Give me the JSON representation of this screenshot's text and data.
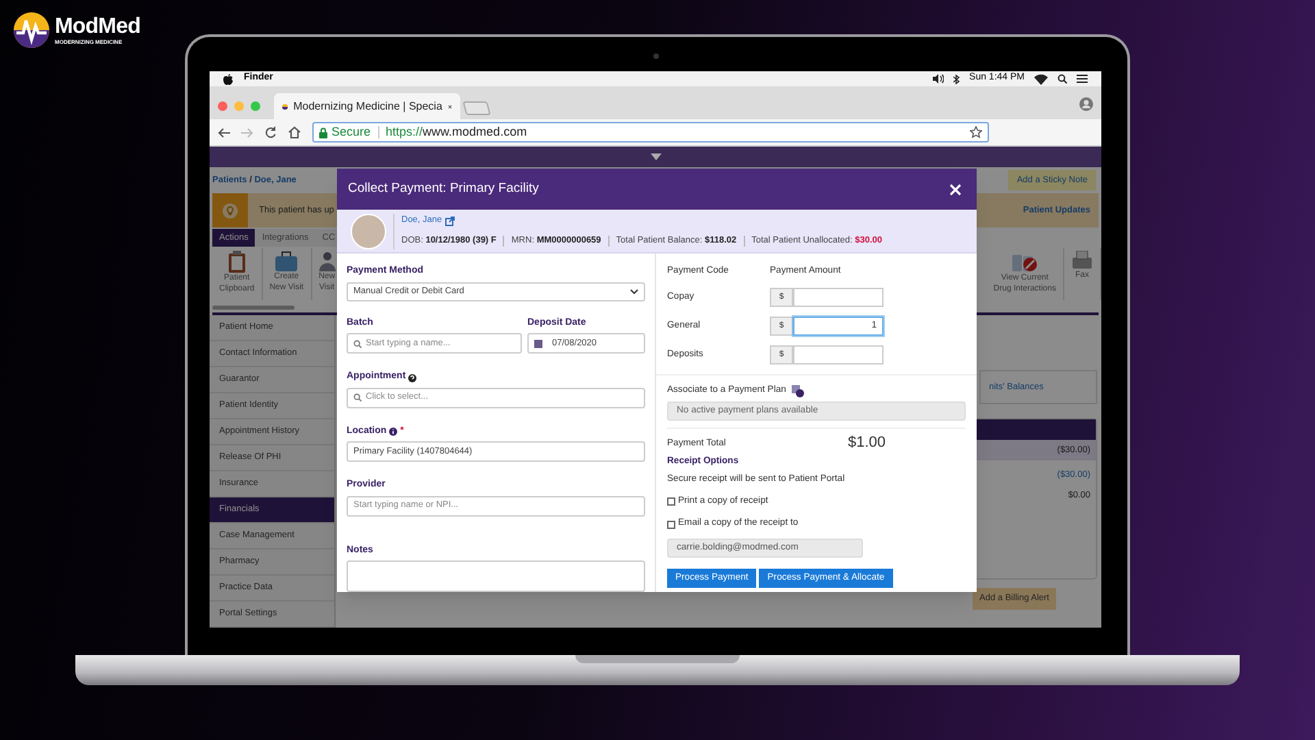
{
  "brand": {
    "name": "ModMed",
    "tagline": "MODERNIZING MEDICINE"
  },
  "menu_bar": {
    "app": "Finder",
    "clock": "Sun 1:44 PM"
  },
  "browser": {
    "tab_title": "Modernizing Medicine | Specia",
    "secure_label": "Secure",
    "url_scheme": "https://",
    "url_host": "www.modmed.com"
  },
  "app": {
    "breadcrumb": [
      {
        "label": "Patients"
      },
      {
        "label": "Doe, Jane"
      }
    ],
    "breadcrumb_separator": "/",
    "sticky_note": "Add a Sticky Note",
    "banner": "This patient has up",
    "patient_updates": "Patient Updates",
    "tabs": [
      {
        "label": "Actions",
        "selected": true
      },
      {
        "label": "Integrations",
        "selected": false
      },
      {
        "label": "CC",
        "selected": false
      }
    ],
    "toolbar": [
      {
        "kind": "clipboard",
        "lines": [
          "Patient",
          "Clipboard"
        ]
      },
      {
        "kind": "visit",
        "lines": [
          "Create",
          "New Visit"
        ]
      },
      {
        "kind": "person",
        "lines": [
          "New",
          "Visit"
        ]
      },
      {
        "kind": "drugs",
        "lines": [
          "View Current",
          "Drug Interactions"
        ]
      },
      {
        "kind": "fax",
        "lines": [
          "Fax"
        ]
      }
    ],
    "sidebar": [
      {
        "label": "Patient Home",
        "selected": false
      },
      {
        "label": "Contact Information",
        "selected": false
      },
      {
        "label": "Guarantor",
        "selected": false
      },
      {
        "label": "Patient Identity",
        "selected": false
      },
      {
        "label": "Appointment History",
        "selected": false
      },
      {
        "label": "Release Of PHI",
        "selected": false
      },
      {
        "label": "Insurance",
        "selected": false
      },
      {
        "label": "Financials",
        "selected": true
      },
      {
        "label": "Case Management",
        "selected": false
      },
      {
        "label": "Pharmacy",
        "selected": false
      },
      {
        "label": "Practice Data",
        "selected": false
      },
      {
        "label": "Portal Settings",
        "selected": false
      }
    ],
    "balances_link": "nits' Balances",
    "balances": [
      "($30.00)",
      "($30.00)",
      "$0.00"
    ],
    "billing_alert": "Add a Billing Alert"
  },
  "modal": {
    "title": "Collect Payment: Primary Facility",
    "patient": {
      "name": "Doe, Jane",
      "dob_label": "DOB:",
      "dob": "10/12/1980 (39) F",
      "mrn_label": "MRN:",
      "mrn": "MM0000000659",
      "balance_label": "Total Patient Balance:",
      "balance": "$118.02",
      "unallocated_label": "Total Patient Unallocated:",
      "unallocated": "$30.00"
    },
    "payment_method": {
      "label": "Payment Method",
      "value": "Manual Credit or Debit Card"
    },
    "batch": {
      "label": "Batch",
      "placeholder": "Start typing a name..."
    },
    "deposit_date": {
      "label": "Deposit Date",
      "value": "07/08/2020"
    },
    "appointment": {
      "label": "Appointment",
      "placeholder": "Click to select..."
    },
    "location": {
      "label": "Location",
      "required": "*",
      "value": "Primary Facility (1407804644)"
    },
    "provider": {
      "label": "Provider",
      "placeholder": "Start typing name or NPI..."
    },
    "notes": {
      "label": "Notes"
    },
    "code_header": "Payment Code",
    "amount_header": "Payment Amount",
    "amounts": [
      {
        "code": "Copay",
        "currency": "$",
        "focused": false
      },
      {
        "code": "General",
        "currency": "$",
        "value": "1",
        "focused": true
      },
      {
        "code": "Deposits",
        "currency": "$",
        "focused": false
      }
    ],
    "plan": {
      "label": "Associate to a Payment Plan",
      "value": "No active payment plans available"
    },
    "total_label": "Payment Total",
    "total": "$1.00",
    "receipt_title": "Receipt Options",
    "receipt_note": "Secure receipt will be sent to Patient Portal",
    "receipt_options": [
      {
        "label": "Print a copy of receipt",
        "checked": false
      },
      {
        "label": "Email a copy of the receipt to",
        "checked": false
      }
    ],
    "email": "carrie.bolding@modmed.com",
    "buttons": [
      "Process Payment",
      "Process Payment & Allocate"
    ]
  }
}
